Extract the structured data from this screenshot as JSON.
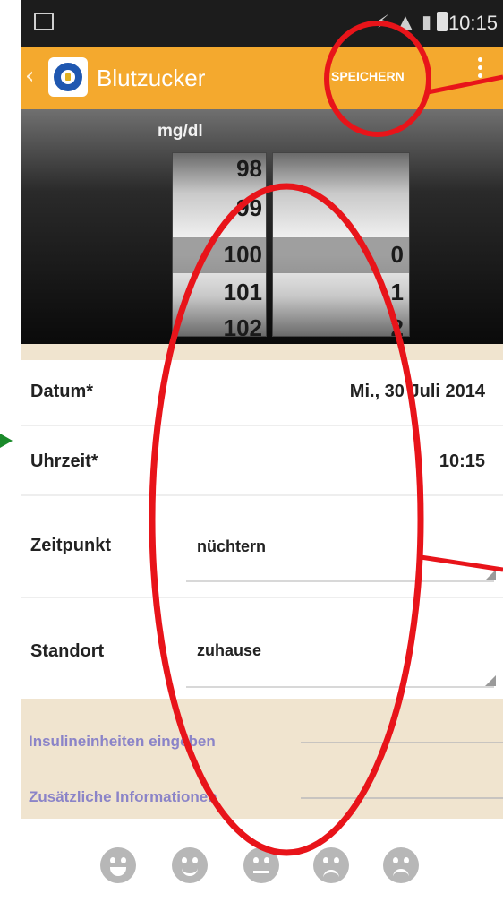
{
  "status_bar": {
    "time": "10:15",
    "icons": "⚡ ▲ ▮"
  },
  "action_bar": {
    "title": "Blutzucker",
    "save_label": "SPEICHERN"
  },
  "picker": {
    "unit": "mg/dl",
    "left_wheel": [
      "98",
      "99",
      "100",
      "101",
      "102"
    ],
    "right_wheel": [
      "0",
      "1",
      "2"
    ]
  },
  "form": {
    "datum": {
      "label": "Datum*",
      "value": "Mi., 30 Juli 2014"
    },
    "uhrzeit": {
      "label": "Uhrzeit*",
      "value": "10:15"
    },
    "zeitpunkt": {
      "label": "Zeitpunkt",
      "value": "nüchtern"
    },
    "standort": {
      "label": "Standort",
      "value": "zuhause"
    }
  },
  "sections": {
    "insulin": "Insulineinheiten eingeben",
    "extra": "Zusätzliche Informationen"
  },
  "moods": [
    "very-happy-icon",
    "happy-icon",
    "neutral-icon",
    "sad-icon",
    "very-sad-icon"
  ],
  "annotation_colors": {
    "ellipse": "#e8141a",
    "arrow": "#1a8a2a"
  }
}
